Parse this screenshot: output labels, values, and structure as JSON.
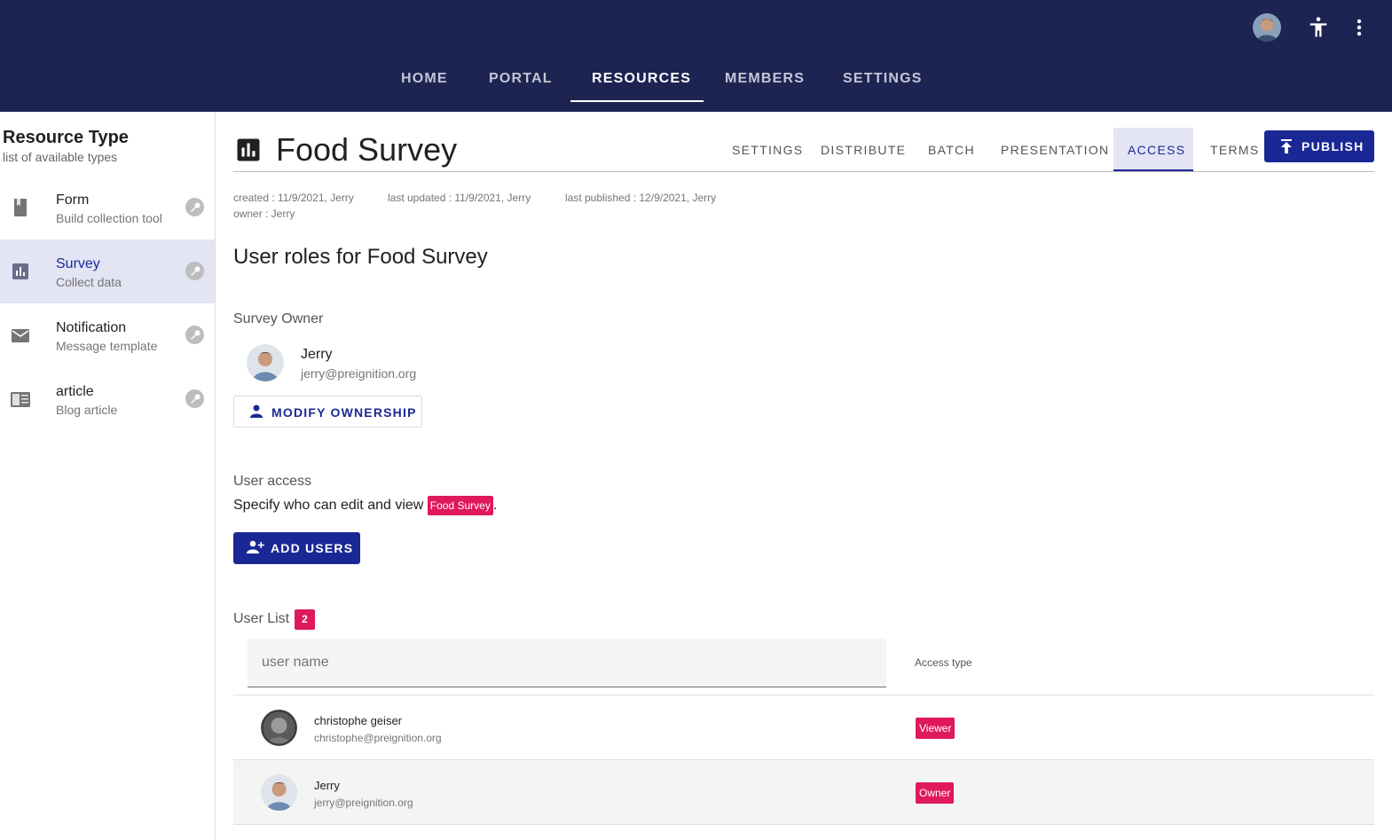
{
  "topnav": {
    "items": [
      "HOME",
      "PORTAL",
      "RESOURCES",
      "MEMBERS",
      "SETTINGS"
    ],
    "active": "RESOURCES"
  },
  "sidebar": {
    "title": "Resource Type",
    "subtitle": "list of available types",
    "items": [
      {
        "label": "Form",
        "sub": "Build collection tool",
        "icon": "book-icon"
      },
      {
        "label": "Survey",
        "sub": "Collect data",
        "icon": "bar-chart-icon",
        "active": true
      },
      {
        "label": "Notification",
        "sub": "Message template",
        "icon": "mail-icon"
      },
      {
        "label": "article",
        "sub": "Blog article",
        "icon": "article-icon"
      }
    ]
  },
  "header": {
    "title": "Food Survey",
    "tabs": [
      "SETTINGS",
      "DISTRIBUTE",
      "BATCH",
      "PRESENTATION",
      "ACCESS",
      "TERMS"
    ],
    "active_tab": "ACCESS",
    "publish_label": "PUBLISH"
  },
  "meta": {
    "created": "created : 11/9/2021, Jerry",
    "updated": "last updated : 11/9/2021, Jerry",
    "published": "last published : 12/9/2021, Jerry",
    "owner": "owner : Jerry"
  },
  "content": {
    "heading": "User roles for Food Survey",
    "owner_section": "Survey Owner",
    "owner": {
      "name": "Jerry",
      "email": "jerry@preignition.org"
    },
    "modify_label": "MODIFY OWNERSHIP",
    "access_section": "User access",
    "access_desc": "Specify who can edit and view",
    "access_chip": "Food Survey",
    "access_end": ".",
    "add_users_label": "ADD USERS",
    "list_title": "User List",
    "list_count": "2",
    "search_placeholder": "user name",
    "access_type_header": "Access type",
    "users": [
      {
        "name": "christophe geiser",
        "email": "christophe@preignition.org",
        "role": "Viewer"
      },
      {
        "name": "Jerry",
        "email": "jerry@preignition.org",
        "role": "Owner"
      }
    ]
  },
  "colors": {
    "topbar": "#1d2451",
    "primary": "#1a2896",
    "accent": "#e0185e",
    "active_bg": "#e3e4f4"
  }
}
